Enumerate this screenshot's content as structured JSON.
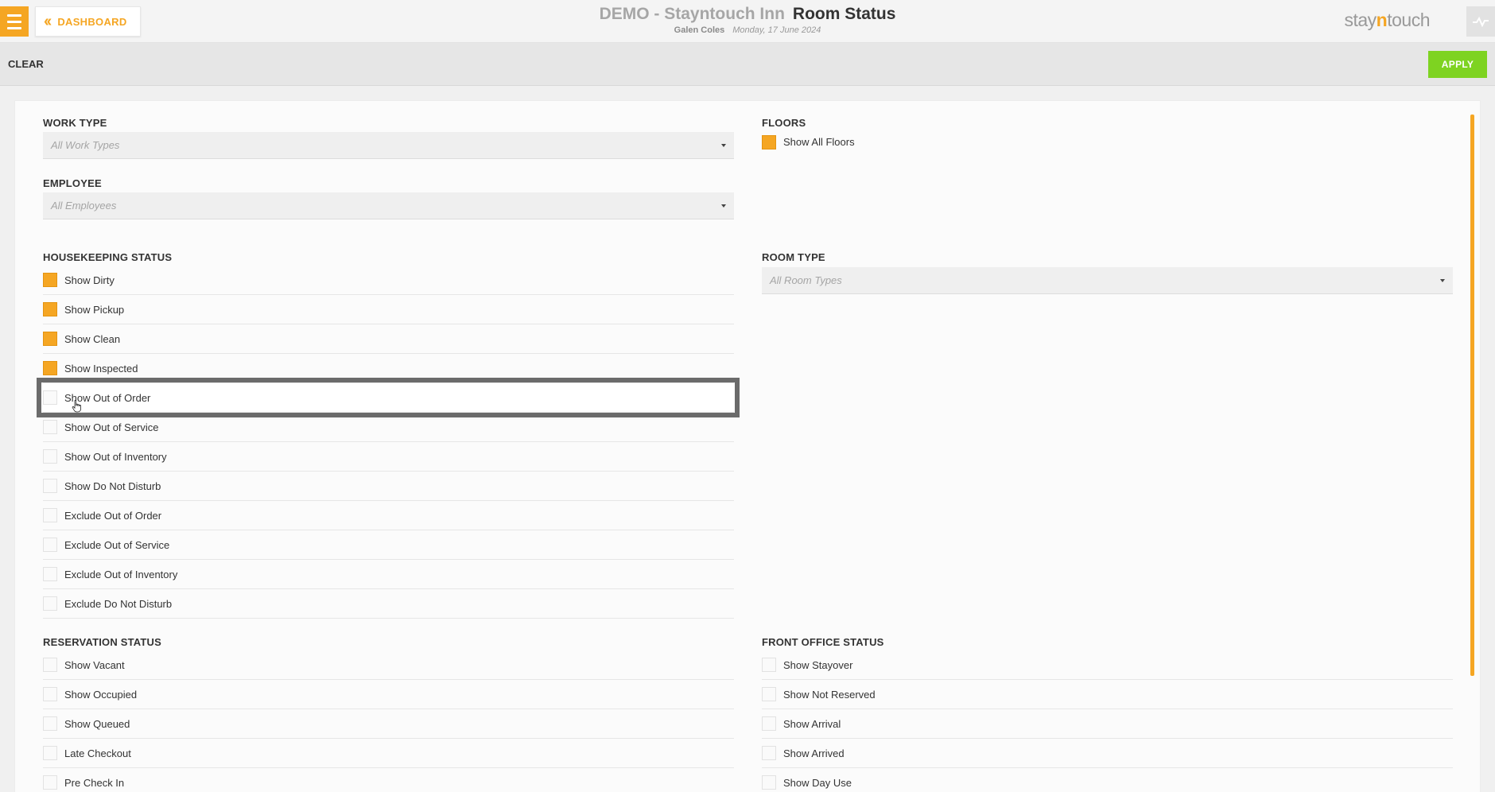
{
  "header": {
    "dashboard_label": "DASHBOARD",
    "hotel_name": "DEMO - Stayntouch Inn",
    "page_title": "Room Status",
    "user_name": "Galen Coles",
    "date": "Monday, 17 June 2024",
    "logo_pre": "stay",
    "logo_n": "n",
    "logo_post": "touch"
  },
  "actions": {
    "clear_label": "CLEAR",
    "apply_label": "APPLY"
  },
  "work_type": {
    "title": "WORK TYPE",
    "placeholder": "All Work Types"
  },
  "employee": {
    "title": "EMPLOYEE",
    "placeholder": "All Employees"
  },
  "floors": {
    "title": "FLOORS",
    "items": [
      {
        "label": "Show All Floors",
        "checked": true
      }
    ]
  },
  "room_type": {
    "title": "ROOM TYPE",
    "placeholder": "All Room Types"
  },
  "housekeeping": {
    "title": "HOUSEKEEPING STATUS",
    "items": [
      {
        "label": "Show Dirty",
        "checked": true
      },
      {
        "label": "Show Pickup",
        "checked": true
      },
      {
        "label": "Show Clean",
        "checked": true
      },
      {
        "label": "Show Inspected",
        "checked": true
      },
      {
        "label": "Show Out of Order",
        "checked": false
      },
      {
        "label": "Show Out of Service",
        "checked": false
      },
      {
        "label": "Show Out of Inventory",
        "checked": false
      },
      {
        "label": "Show Do Not Disturb",
        "checked": false
      },
      {
        "label": "Exclude Out of Order",
        "checked": false
      },
      {
        "label": "Exclude Out of Service",
        "checked": false
      },
      {
        "label": "Exclude Out of Inventory",
        "checked": false
      },
      {
        "label": "Exclude Do Not Disturb",
        "checked": false
      }
    ]
  },
  "reservation": {
    "title": "RESERVATION STATUS",
    "items": [
      {
        "label": "Show Vacant",
        "checked": false
      },
      {
        "label": "Show Occupied",
        "checked": false
      },
      {
        "label": "Show Queued",
        "checked": false
      },
      {
        "label": "Late Checkout",
        "checked": false
      },
      {
        "label": "Pre Check In",
        "checked": false
      }
    ]
  },
  "front_office": {
    "title": "FRONT OFFICE STATUS",
    "items": [
      {
        "label": "Show Stayover",
        "checked": false
      },
      {
        "label": "Show Not Reserved",
        "checked": false
      },
      {
        "label": "Show Arrival",
        "checked": false
      },
      {
        "label": "Show Arrived",
        "checked": false
      },
      {
        "label": "Show Day Use",
        "checked": false
      }
    ]
  },
  "colors": {
    "accent": "#f5a623",
    "apply": "#7ed321"
  }
}
